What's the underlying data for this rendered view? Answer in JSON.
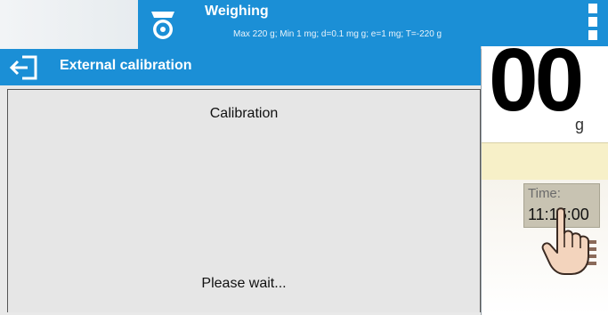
{
  "main": {
    "title": "Weighing",
    "subtitle": "Max 220 g; Min 1 mg; d=0.1 mg g; e=1 mg; T=-220 g",
    "reading_value": "00",
    "reading_unit": "g",
    "time_label": "Time:",
    "time_value": "11:15:00"
  },
  "dialog": {
    "title": "External calibration",
    "subtitle": "Calibration",
    "status_text": "Please wait..."
  },
  "colors": {
    "accent": "#1b8fd6",
    "dialog_background": "#e9e9e9",
    "info_band": "#f7f0c8"
  },
  "icons": {
    "mode": "scale-icon",
    "menu": "menu-dots-icon",
    "back": "exit-arrow-icon",
    "pointer": "hand-pointer-icon"
  }
}
